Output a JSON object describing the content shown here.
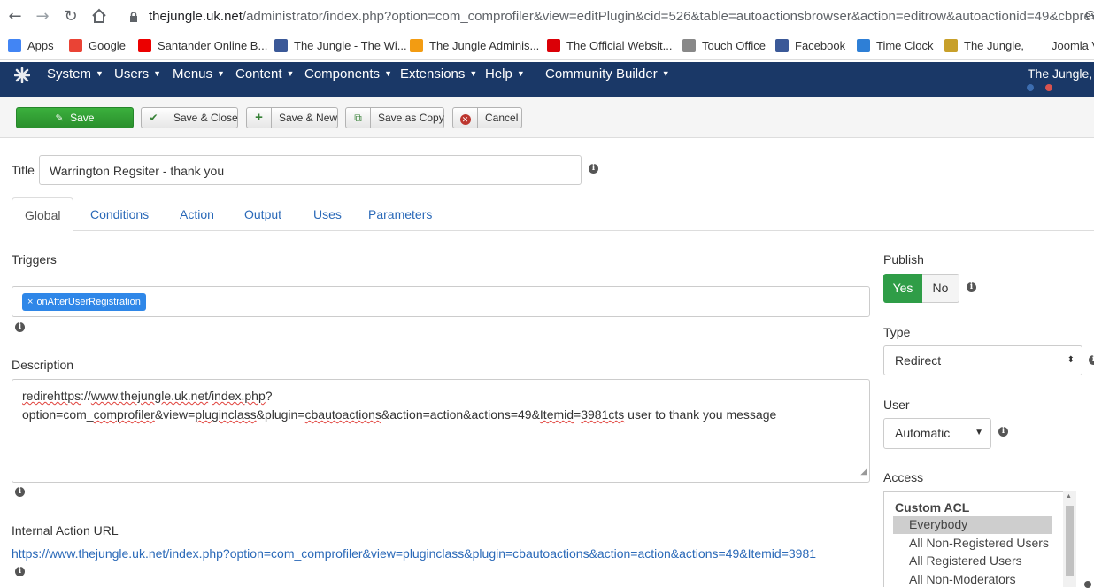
{
  "browser": {
    "url_host": "thejungle.uk.net",
    "url_path": "/administrator/index.php?option=com_comprofiler&view=editPlugin&cid=526&table=autoactionsbrowser&action=editrow&autoactionid=49&cbprev...",
    "bookmarks": [
      {
        "label": "Apps",
        "icon": "apps-grid-icon",
        "color": "#4285f4"
      },
      {
        "label": "Google",
        "icon": "google-icon",
        "color": "#ea4335"
      },
      {
        "label": "Santander Online B...",
        "icon": "santander-icon",
        "color": "#ec0000"
      },
      {
        "label": "The Jungle - The Wi...",
        "icon": "facebook-icon",
        "color": "#3b5998"
      },
      {
        "label": "The Jungle Adminis...",
        "icon": "joomla-icon",
        "color": "#f39c12"
      },
      {
        "label": "The Official Websit...",
        "icon": "arsenal-shield-icon",
        "color": "#db0007"
      },
      {
        "label": "Touch Office",
        "icon": "touch-office-icon",
        "color": "#888888"
      },
      {
        "label": "Facebook",
        "icon": "facebook-icon",
        "color": "#3b5998"
      },
      {
        "label": "Time Clock",
        "icon": "time-clock-icon",
        "color": "#2e7fd6"
      },
      {
        "label": "The Jungle,",
        "icon": "jungle-logo-icon",
        "color": "#c8a02a"
      },
      {
        "label": "Joomla V",
        "icon": "",
        "color": ""
      }
    ]
  },
  "nav": {
    "menus": [
      "System",
      "Users",
      "Menus",
      "Content",
      "Components",
      "Extensions",
      "Help",
      "Community Builder"
    ],
    "site_name": "The Jungle,"
  },
  "toolbar": {
    "save": "Save",
    "save_close": "Save & Close",
    "save_new": "Save & New",
    "save_copy": "Save as Copy",
    "cancel": "Cancel"
  },
  "form": {
    "title_label": "Title",
    "title_value": "Warrington Regsiter - thank you",
    "tabs": [
      "Global",
      "Conditions",
      "Action",
      "Output",
      "Uses",
      "Parameters"
    ],
    "triggers_label": "Triggers",
    "trigger_chip": "onAfterUserRegistration",
    "description_label": "Description",
    "description_line1": "redirehttps://www.thejungle.uk.net/index.php?",
    "description_line2": "option=com_comprofiler&view=pluginclass&plugin=cbautoactions&action=action&actions=49&Itemid=3981cts user to thank you message",
    "internal_url_label": "Internal Action URL",
    "internal_url": "https://www.thejungle.uk.net/index.php?option=com_comprofiler&view=pluginclass&plugin=cbautoactions&action=action&actions=49&Itemid=3981"
  },
  "side": {
    "publish_label": "Publish",
    "yes": "Yes",
    "no": "No",
    "type_label": "Type",
    "type_value": "Redirect",
    "user_label": "User",
    "user_value": "Automatic",
    "access_label": "Access",
    "access_group": "Custom ACL",
    "access_options": [
      "Everybody",
      "All Non-Registered Users",
      "All Registered Users",
      "All Non-Moderators"
    ],
    "access_selected": "Everybody"
  }
}
